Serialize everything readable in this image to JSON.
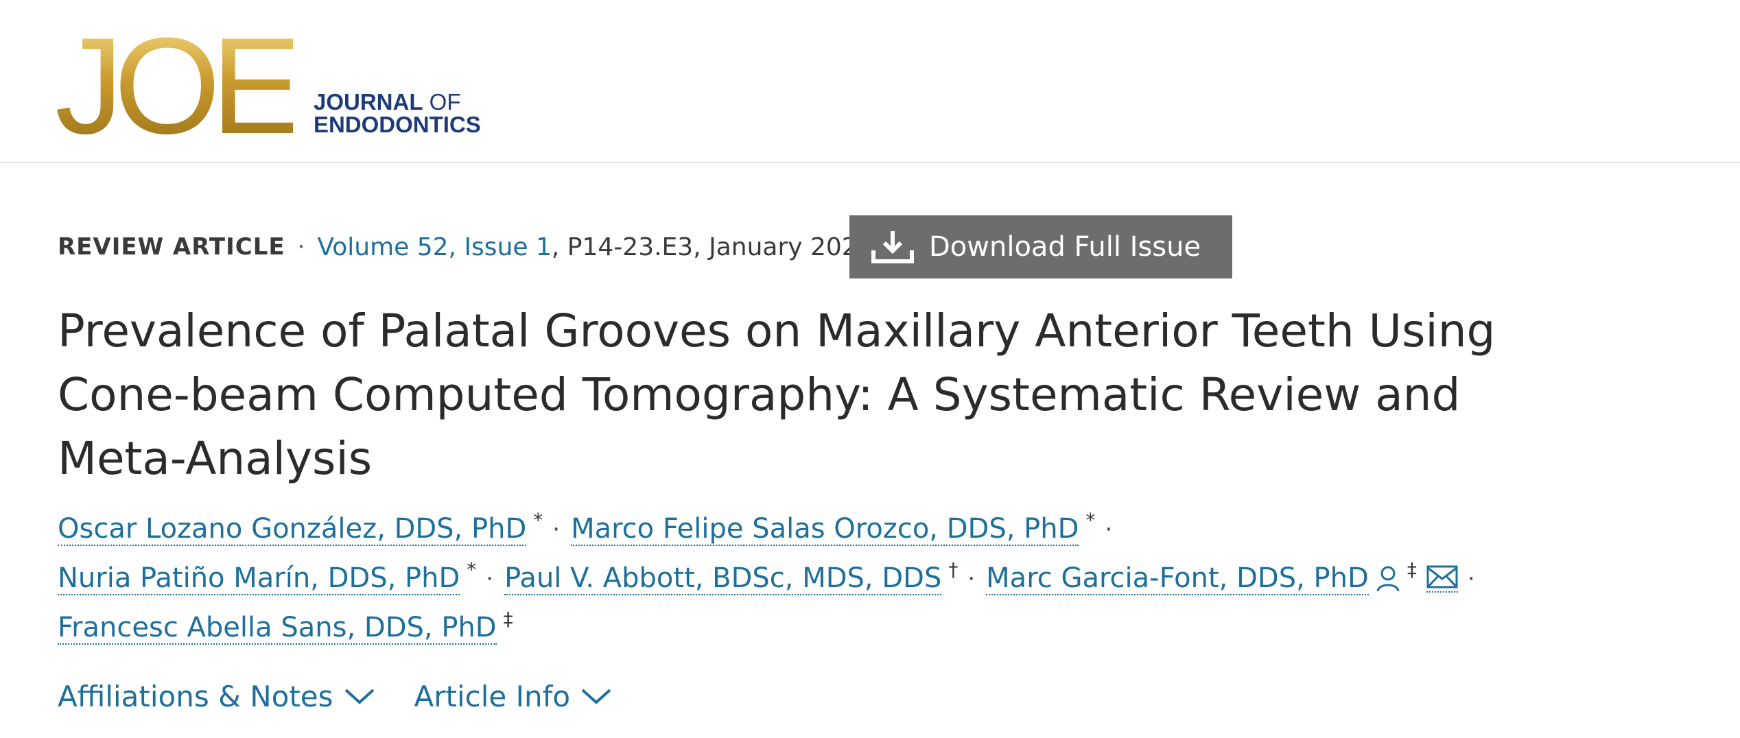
{
  "brand": {
    "mark": "JOE",
    "name_line1_bold": "JOURNAL",
    "name_line1_thin": " OF",
    "name_line2": "ENDODONTICS"
  },
  "meta": {
    "type": "REVIEW ARTICLE",
    "separator": "·",
    "volume_issue": "Volume 52, Issue 1",
    "pages_date": ", P14-23.E3, January 2026"
  },
  "download": {
    "label": "Download Full Issue",
    "icon": "download-icon"
  },
  "title": "Prevalence of Palatal Grooves on Maxillary Anterior Teeth Using Cone-beam Computed Tomography: A Systematic Review and Meta-Analysis",
  "authors": [
    {
      "name": "Oscar Lozano González, DDS, PhD",
      "mark": "*"
    },
    {
      "name": "Marco Felipe Salas Orozco, DDS, PhD",
      "mark": "*"
    },
    {
      "name": "Nuria Patiño Marín, DDS, PhD",
      "mark": "*"
    },
    {
      "name": "Paul V. Abbott, BDSc, MDS, DDS",
      "mark": "†"
    },
    {
      "name": "Marc Garcia-Font, DDS, PhD",
      "mark": "‡",
      "icons": [
        "person-icon",
        "mail-icon"
      ]
    },
    {
      "name": "Francesc Abella Sans, DDS, PhD",
      "mark": "‡"
    }
  ],
  "author_separator": "·",
  "sections": {
    "affiliations": "Affiliations & Notes",
    "article_info": "Article Info"
  },
  "colors": {
    "link": "#1d6f9c",
    "button": "#6d6d6d",
    "brand_navy": "#1d3b7a",
    "brand_gold": "#c79c2e"
  }
}
